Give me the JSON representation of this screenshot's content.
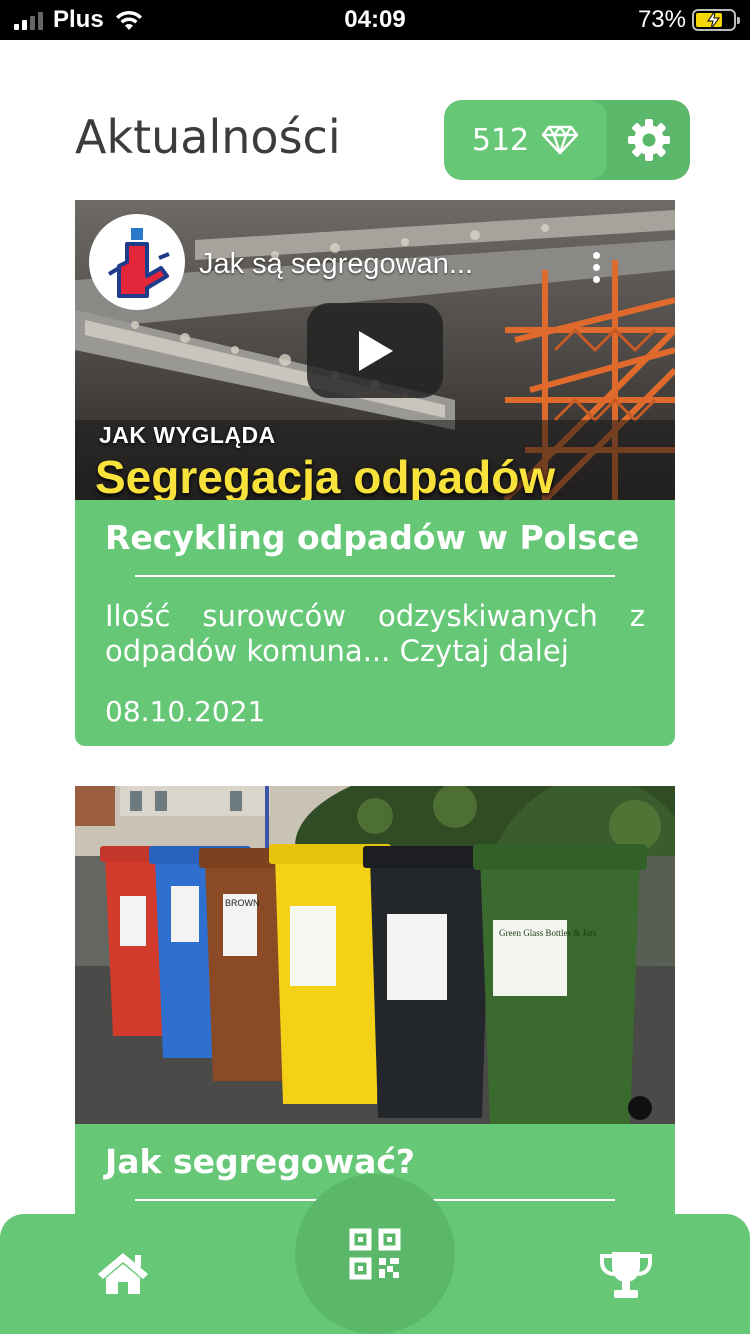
{
  "status_bar": {
    "carrier": "Plus",
    "time": "04:09",
    "battery": "73%",
    "icons": [
      "signal-icon",
      "wifi-icon",
      "battery-charging-icon"
    ]
  },
  "header": {
    "title": "Aktualności",
    "points": "512",
    "points_icon": "diamond-icon",
    "settings_icon": "gear-icon"
  },
  "news": [
    {
      "video_title": "Jak są segregowan...",
      "video_caption_small": "JAK WYGLĄDA",
      "video_caption_big": "Segregacja odpadów",
      "title": "Recykling odpadów w Polsce",
      "description": "Ilość surowców odzyskiwanych z odpadów komuna... Czytaj dalej",
      "date": "08.10.2021"
    },
    {
      "image_icon": "recycling-bins-image",
      "bin_labels": [
        "BROWN",
        "Green Glass Bottles & Jars"
      ],
      "title": "Jak segregować?"
    }
  ],
  "bottom_nav": {
    "home_icon": "home-icon",
    "scan_icon": "qr-code-icon",
    "trophy_icon": "trophy-icon"
  },
  "colors": {
    "accent": "#66c877",
    "accent_dark": "#5bb76a",
    "title_text": "#3c3c3c"
  }
}
